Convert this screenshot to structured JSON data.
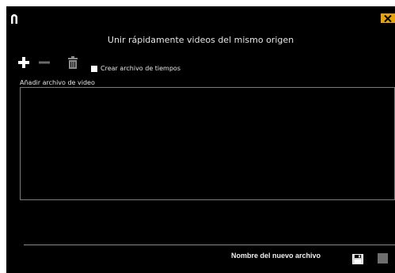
{
  "window": {
    "title": "Unir rápidamente videos del mismo origen",
    "accent_color": "#e8a20c",
    "logo_icon": "magnet-icon",
    "close_icon": "close-icon"
  },
  "toolbar": {
    "add_icon": "plus-icon",
    "remove_icon": "minus-icon",
    "delete_icon": "trash-icon",
    "create_timefile_label": "Crear archivo de tiempos",
    "create_timefile_checked": true
  },
  "video_list": {
    "label": "Añadir archivo de video",
    "items": []
  },
  "footer": {
    "new_file_label": "Nombre del nuevo archivo",
    "save_icon": "floppy-icon"
  }
}
